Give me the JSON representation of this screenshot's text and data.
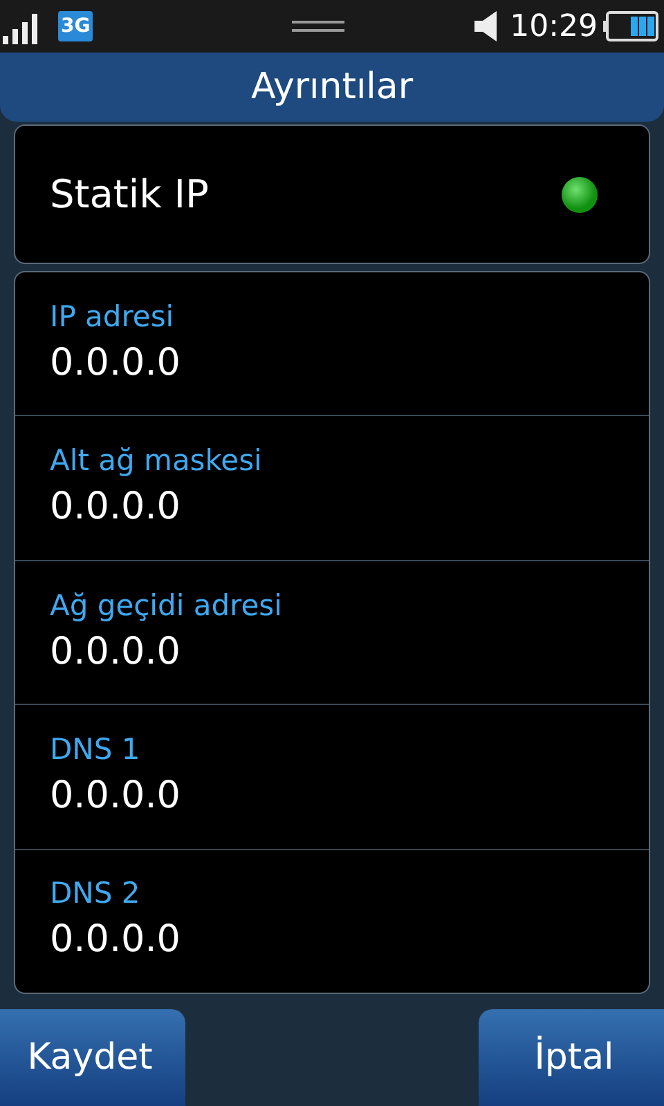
{
  "status_bar": {
    "network_type": "3G",
    "time": "10:29"
  },
  "title": "Ayrıntılar",
  "static_ip": {
    "label": "Statik IP",
    "on": true
  },
  "fields": [
    {
      "label": "IP adresi",
      "value": "0.0.0.0"
    },
    {
      "label": "Alt ağ maskesi",
      "value": "0.0.0.0"
    },
    {
      "label": "Ağ geçidi adresi",
      "value": "0.0.0.0"
    },
    {
      "label": "DNS 1",
      "value": "0.0.0.0"
    },
    {
      "label": "DNS 2",
      "value": "0.0.0.0"
    }
  ],
  "buttons": [
    "Kaydet",
    "İptal"
  ]
}
